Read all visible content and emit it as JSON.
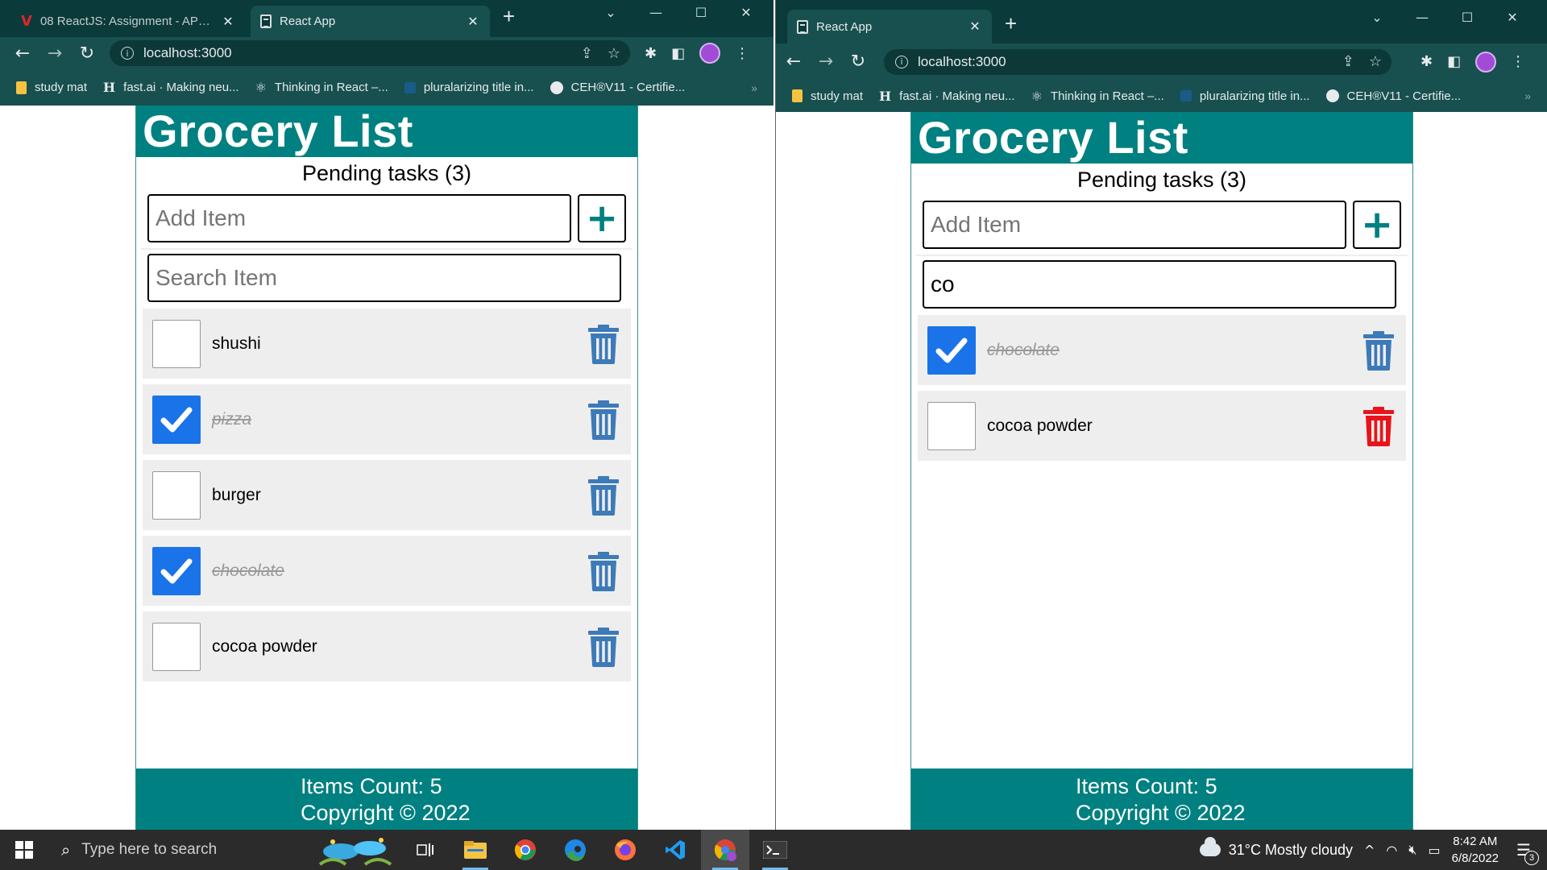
{
  "left_window": {
    "tabs": [
      {
        "title": "08 ReactJS: Assignment - API anc",
        "active": false
      },
      {
        "title": "React App",
        "active": true
      }
    ],
    "url": "localhost:3000",
    "bookmarks": [
      "study mat",
      "fast.ai · Making neu...",
      "Thinking in React –...",
      "pluralarizing title in...",
      "CEH®V11 - Certifie..."
    ],
    "app": {
      "title": "Grocery List",
      "pending": "Pending tasks (3)",
      "add_placeholder": "Add Item",
      "add_button": "+",
      "search_placeholder": "Search Item",
      "search_value": "",
      "items": [
        {
          "label": "shushi",
          "checked": false,
          "trash_color": "#3d7ab8"
        },
        {
          "label": "pizza",
          "checked": true,
          "trash_color": "#3d7ab8"
        },
        {
          "label": "burger",
          "checked": false,
          "trash_color": "#3d7ab8"
        },
        {
          "label": "chocolate",
          "checked": true,
          "trash_color": "#3d7ab8"
        },
        {
          "label": "cocoa powder",
          "checked": false,
          "trash_color": "#3d7ab8"
        }
      ],
      "footer_count": "Items Count: 5",
      "footer_copyright": "Copyright © 2022"
    }
  },
  "right_window": {
    "tabs": [
      {
        "title": "React App",
        "active": true
      }
    ],
    "url": "localhost:3000",
    "bookmarks": [
      "study mat",
      "fast.ai · Making neu...",
      "Thinking in React –...",
      "pluralarizing title in...",
      "CEH®V11 - Certifie..."
    ],
    "app": {
      "title": "Grocery List",
      "pending": "Pending tasks (3)",
      "add_placeholder": "Add Item",
      "add_button": "+",
      "search_placeholder": "Search Item",
      "search_value": "co",
      "items": [
        {
          "label": "chocolate",
          "checked": true,
          "trash_color": "#3d7ab8"
        },
        {
          "label": "cocoa powder",
          "checked": false,
          "trash_color": "#e8141a"
        }
      ],
      "footer_count": "Items Count: 5",
      "footer_copyright": "Copyright © 2022"
    }
  },
  "taskbar": {
    "search_placeholder": "Type here to search",
    "weather": "31°C  Mostly cloudy",
    "time": "8:42 AM",
    "date": "6/8/2022",
    "notifications": "3"
  },
  "colors": {
    "app_teal": "#008080",
    "browser_frame": "#0a3a3a",
    "checkbox_blue": "#1a73e8",
    "trash_blue": "#3d7ab8",
    "trash_red": "#e8141a"
  }
}
